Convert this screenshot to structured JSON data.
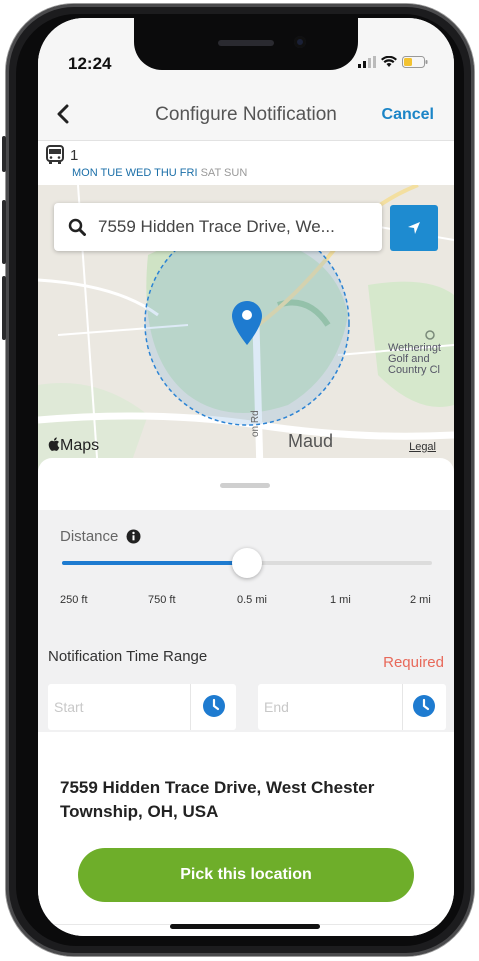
{
  "status_bar": {
    "time": "12:24"
  },
  "nav": {
    "title": "Configure Notification",
    "cancel_label": "Cancel"
  },
  "route": {
    "number": "1",
    "days": [
      {
        "label": "MON",
        "active": true
      },
      {
        "label": "TUE",
        "active": true
      },
      {
        "label": "WED",
        "active": true
      },
      {
        "label": "THU",
        "active": true
      },
      {
        "label": "FRI",
        "active": true
      },
      {
        "label": "SAT",
        "active": false
      },
      {
        "label": "SUN",
        "active": false
      }
    ]
  },
  "search": {
    "value": "7559 Hidden Trace Drive, We..."
  },
  "map": {
    "logo": "Maps",
    "legal_label": "Legal",
    "place_labels": [
      "Maud",
      "Wetheringt",
      "Golf and",
      "Country Cl"
    ],
    "road_label": "on Rd"
  },
  "distance": {
    "label": "Distance",
    "ticks": [
      "250 ft",
      "750 ft",
      "0.5 mi",
      "1 mi",
      "2 mi"
    ],
    "selected_fraction": 0.5
  },
  "time_range": {
    "label": "Notification Time Range",
    "required_label": "Required",
    "start_placeholder": "Start",
    "end_placeholder": "End"
  },
  "address_line1": "7559 Hidden Trace Drive, West Chester",
  "address_line2": "Township, OH, USA",
  "pick_button_label": "Pick this location",
  "colors": {
    "accent_blue": "#1e8bd0",
    "button_green": "#6eae2a",
    "required_red": "#e8695a"
  }
}
